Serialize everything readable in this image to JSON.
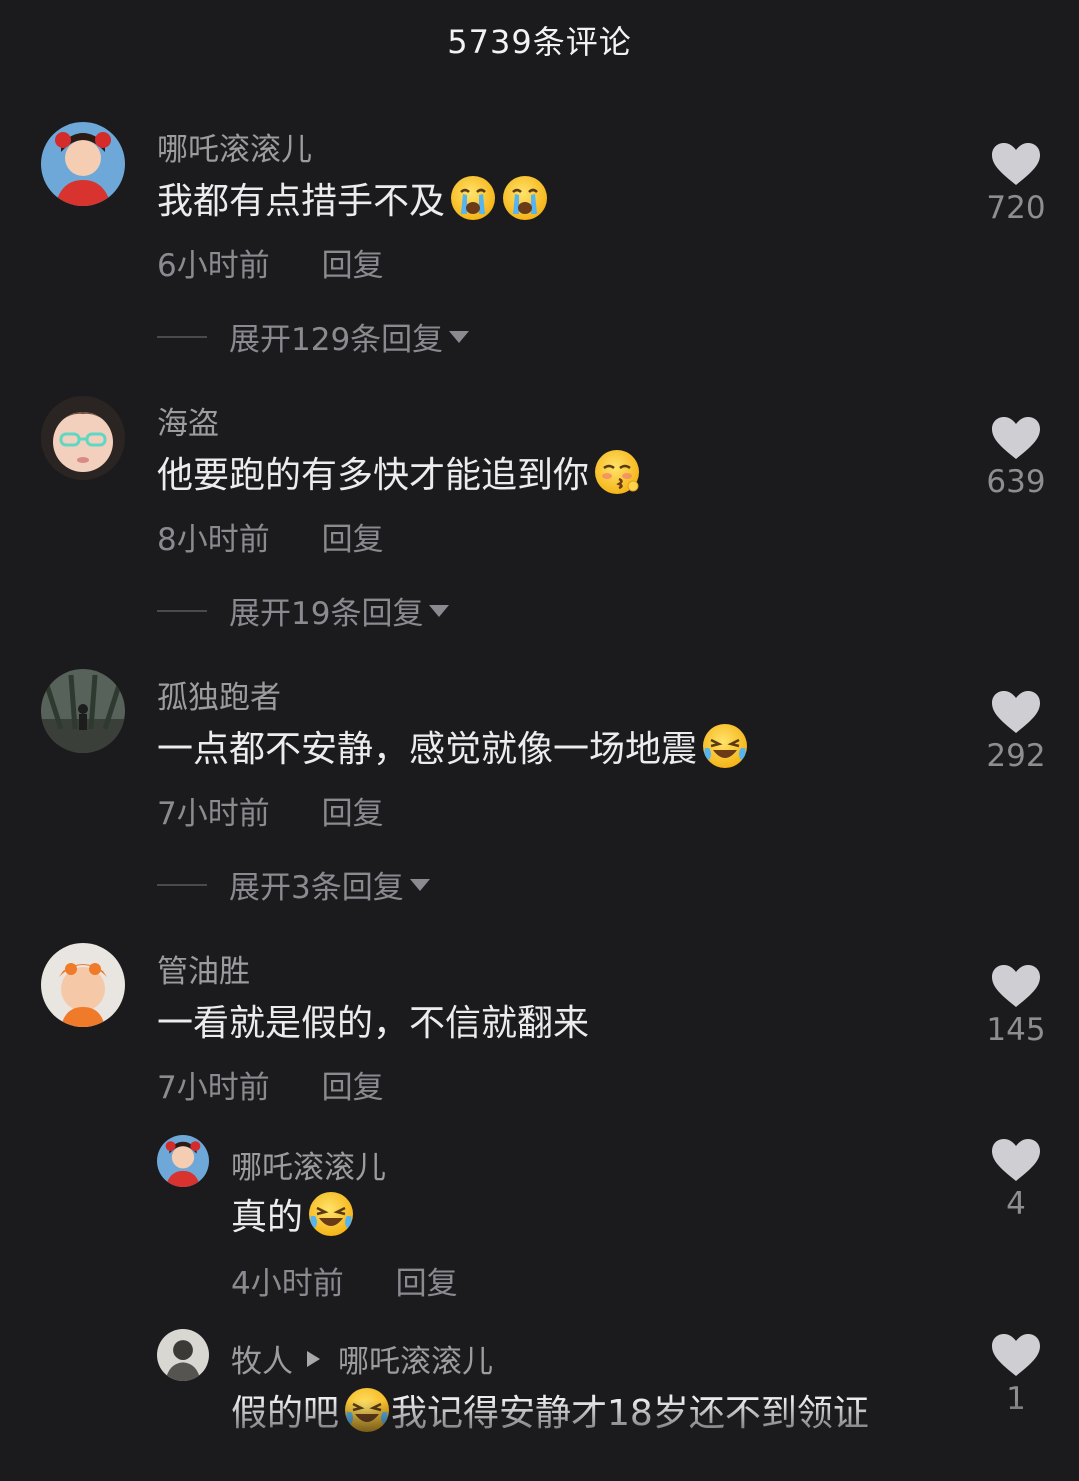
{
  "header": {
    "title": "5739条评论"
  },
  "icons": {
    "like": "heart-icon",
    "expand": "caret-down-icon",
    "reply_to": "play-arrow-icon"
  },
  "colors": {
    "background": "#1b1b1d",
    "text": "#ececee",
    "muted": "#8a8a90",
    "heart": "#cfcfd3"
  },
  "comments": [
    {
      "username": "哪吒滚滚儿",
      "text": "我都有点措手不及",
      "emojis": [
        "crying-face-emoji",
        "crying-face-emoji"
      ],
      "time": "6小时前",
      "reply": "回复",
      "expand": "展开129条回复",
      "likes": "720"
    },
    {
      "username": "海盗",
      "text": "他要跑的有多快才能追到你",
      "emojis": [
        "kissing-face-emoji"
      ],
      "time": "8小时前",
      "reply": "回复",
      "expand": "展开19条回复",
      "likes": "639"
    },
    {
      "username": "孤独跑者",
      "text": "一点都不安静，感觉就像一场地震",
      "emojis": [
        "laughing-tears-emoji"
      ],
      "time": "7小时前",
      "reply": "回复",
      "expand": "展开3条回复",
      "likes": "292"
    },
    {
      "username": "管油胜",
      "text": "一看就是假的，不信就翻来",
      "time": "7小时前",
      "reply": "回复",
      "likes": "145"
    }
  ],
  "replies": [
    {
      "username": "哪吒滚滚儿",
      "text": "真的",
      "emojis": [
        "laughing-tears-emoji"
      ],
      "time": "4小时前",
      "reply": "回复",
      "likes": "4"
    },
    {
      "username": "牧人",
      "reply_to": "哪吒滚滚儿",
      "text_before": "假的吧",
      "text_after": "我记得安静才18岁还不到领证",
      "emojis": [
        "laughing-tears-emoji"
      ],
      "likes": "1"
    }
  ]
}
